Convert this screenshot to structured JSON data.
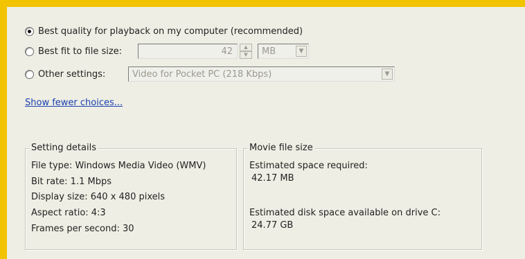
{
  "options": {
    "best_quality_label": "Best quality for playback on my computer (recommended)",
    "best_fit_label": "Best fit to file size:",
    "other_settings_label": "Other settings:",
    "selected": "best_quality"
  },
  "file_size": {
    "value": "42",
    "unit": "MB"
  },
  "other_settings_value": "Video for Pocket PC (218 Kbps)",
  "show_fewer_link": "Show fewer choices...",
  "setting_details": {
    "title": "Setting details",
    "file_type": "File type: Windows Media Video (WMV)",
    "bit_rate": "Bit rate: 1.1 Mbps",
    "display_size": "Display size: 640 x 480 pixels",
    "aspect_ratio": "Aspect ratio: 4:3",
    "fps": "Frames per second: 30"
  },
  "movie_file_size": {
    "title": "Movie file size",
    "estimated_label": "Estimated space required:",
    "estimated_value": "42.17 MB",
    "disk_label": "Estimated disk space available on drive C:",
    "disk_value": "24.77 GB"
  }
}
